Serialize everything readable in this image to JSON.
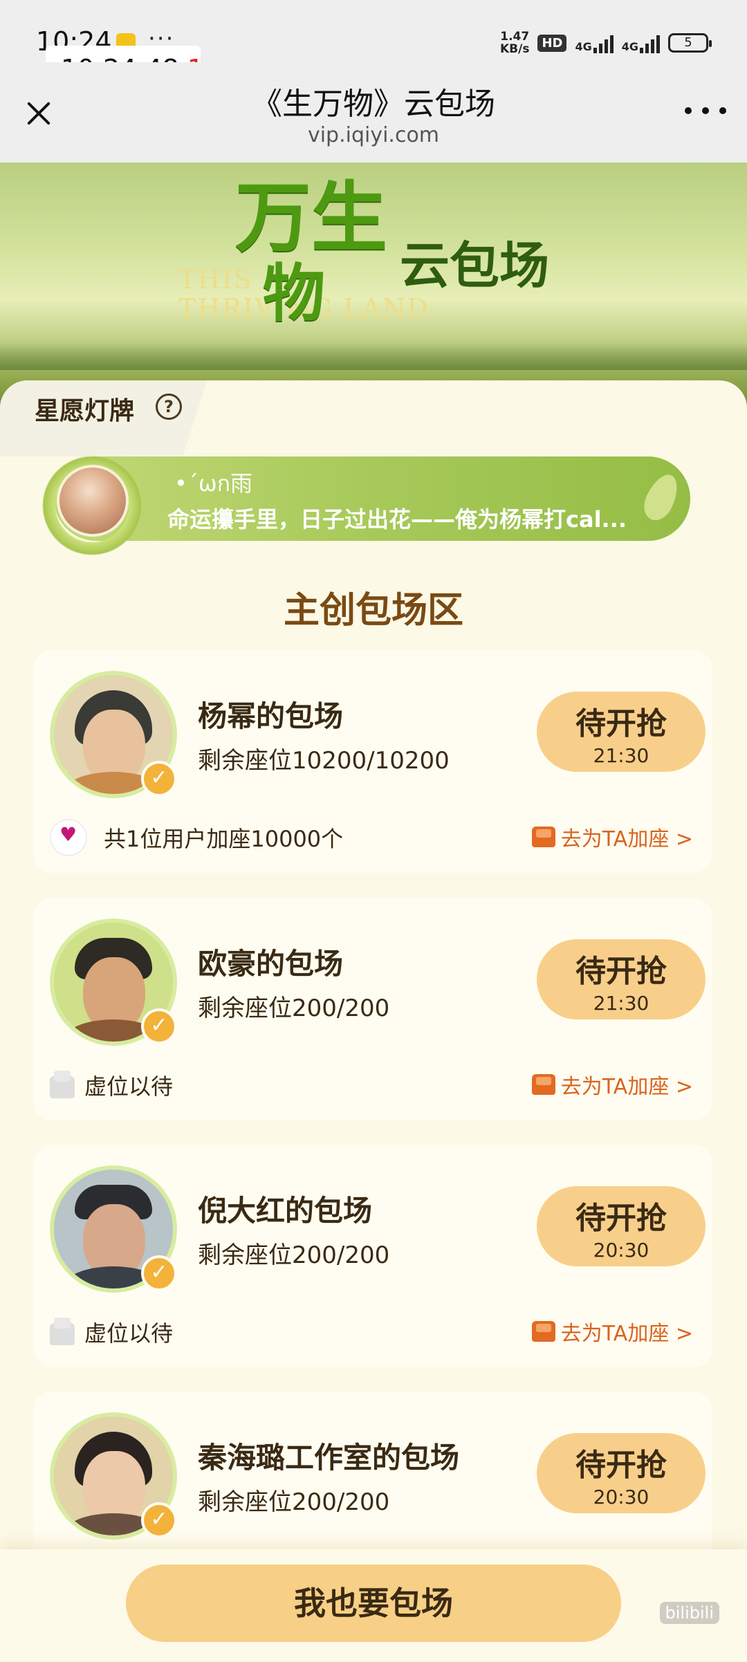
{
  "status_bar": {
    "time": "10:24",
    "more": "···",
    "clock_main": "10:24:48.",
    "clock_ms": "1",
    "net_speed": "1.47",
    "net_unit": "KB/s",
    "hd": "HD",
    "sig1": "4G",
    "sig2": "4G",
    "battery": "5"
  },
  "header": {
    "title": "《生万物》云包场",
    "url": "vip.iqiyi.com"
  },
  "banner": {
    "en_title_line1": "THIS",
    "en_title_line2": "THRIVING LAND",
    "logo_line1": "万生",
    "logo_line2": "物",
    "subtitle": "云包场"
  },
  "wish_section": {
    "tab_label": "星愿灯牌",
    "help": "?",
    "user": "•´ωก雨",
    "message": "命运攥手里，日子过出花——俺为杨幂打cal..."
  },
  "section_title": "主创包场区",
  "cards": [
    {
      "name": "杨幂的包场",
      "seats": "剩余座位10200/10200",
      "button": "待开抢",
      "time": "21:30",
      "footer": "共1位用户加座10000个",
      "link": "去为TA加座 >",
      "verified": "✓"
    },
    {
      "name": "欧豪的包场",
      "seats": "剩余座位200/200",
      "button": "待开抢",
      "time": "21:30",
      "footer": "虚位以待",
      "link": "去为TA加座 >",
      "verified": "✓"
    },
    {
      "name": "倪大红的包场",
      "seats": "剩余座位200/200",
      "button": "待开抢",
      "time": "20:30",
      "footer": "虚位以待",
      "link": "去为TA加座 >",
      "verified": "✓"
    },
    {
      "name": "秦海璐工作室的包场",
      "seats": "剩余座位200/200",
      "button": "待开抢",
      "time": "20:30",
      "verified": "✓"
    }
  ],
  "cta": "我也要包场",
  "watermark": "bilibili",
  "colors": {
    "accent": "#f7cf86",
    "link": "#d9631e",
    "title_brown": "#7a4a14",
    "wish_green": "#a7c95a"
  }
}
